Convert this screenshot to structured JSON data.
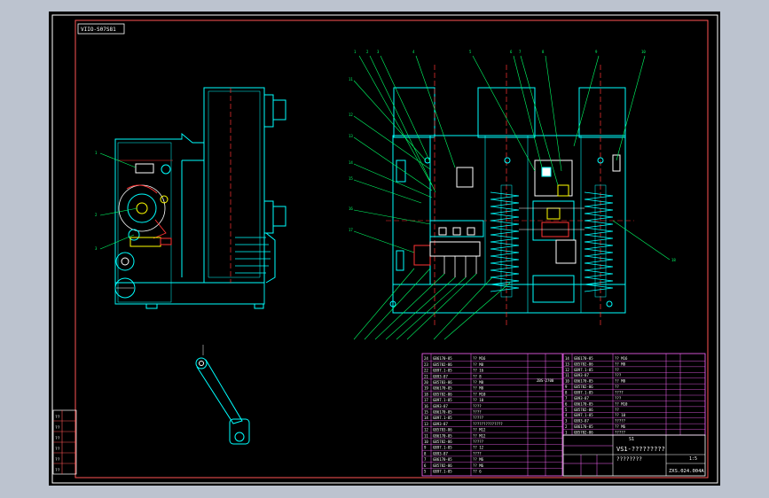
{
  "drawing": {
    "code_stamp": "VIIO-S07S81",
    "title_left": "VS1-?????????",
    "title_right": "????????",
    "title_code": "ZXS.024.004A",
    "scale_label": "1:5"
  },
  "bom_left": [
    [
      "24",
      "GB6170-85",
      "?? M16"
    ],
    [
      "23",
      "GB5782-86",
      "?? M8"
    ],
    [
      "22",
      "GB97.1-85",
      "?? 16"
    ],
    [
      "21",
      "GB93-87",
      "?? 8"
    ],
    [
      "20",
      "GB5783-86",
      "?? M8"
    ],
    [
      "19",
      "GB6170-85",
      "?? M8"
    ],
    [
      "18",
      "GB5782-86",
      "?? M10"
    ],
    [
      "17",
      "GB97.1-85",
      "?? 10"
    ],
    [
      "16",
      "GB93-87",
      "????"
    ],
    [
      "15",
      "GB6170-85",
      "????"
    ],
    [
      "14",
      "GB97.1-85",
      "?????"
    ],
    [
      "13",
      "GB93-87",
      "??????????????"
    ],
    [
      "12",
      "GB5783-86",
      "?? M12"
    ],
    [
      "11",
      "GB6170-85",
      "?? M12"
    ],
    [
      "10",
      "GB5782-86",
      "?????"
    ],
    [
      "9",
      "GB97.1-85",
      "?? 12"
    ],
    [
      "8",
      "GB93-87",
      "????"
    ],
    [
      "7",
      "GB6170-85",
      "?? M6"
    ],
    [
      "6",
      "GB5782-86",
      "?? M6"
    ],
    [
      "5",
      "GB97.1-85",
      "?? 6"
    ]
  ],
  "bom_right": [
    [
      "14",
      "GB6170-85",
      "?? M16"
    ],
    [
      "13",
      "GB5782-86",
      "?? M8"
    ],
    [
      "12",
      "GB97.1-85",
      "??"
    ],
    [
      "11",
      "GB93-87",
      "???"
    ],
    [
      "10",
      "GB6170-85",
      "?? M8"
    ],
    [
      "9",
      "GB5782-86",
      "??"
    ],
    [
      "8",
      "GB97.1-85",
      "????"
    ],
    [
      "7",
      "GB93-87",
      "???"
    ],
    [
      "6",
      "GB6170-85",
      "?? M10"
    ],
    [
      "5",
      "GB5782-86",
      "??"
    ],
    [
      "4",
      "GB97.1-85",
      "?? 10"
    ],
    [
      "3",
      "GB93-87",
      "?????"
    ],
    [
      "2",
      "GB6170-85",
      "?? M6"
    ],
    [
      "1",
      "GB5782-86",
      "?????"
    ]
  ],
  "revision_block": [
    "??",
    "??",
    "??",
    "??",
    "??",
    "??"
  ]
}
